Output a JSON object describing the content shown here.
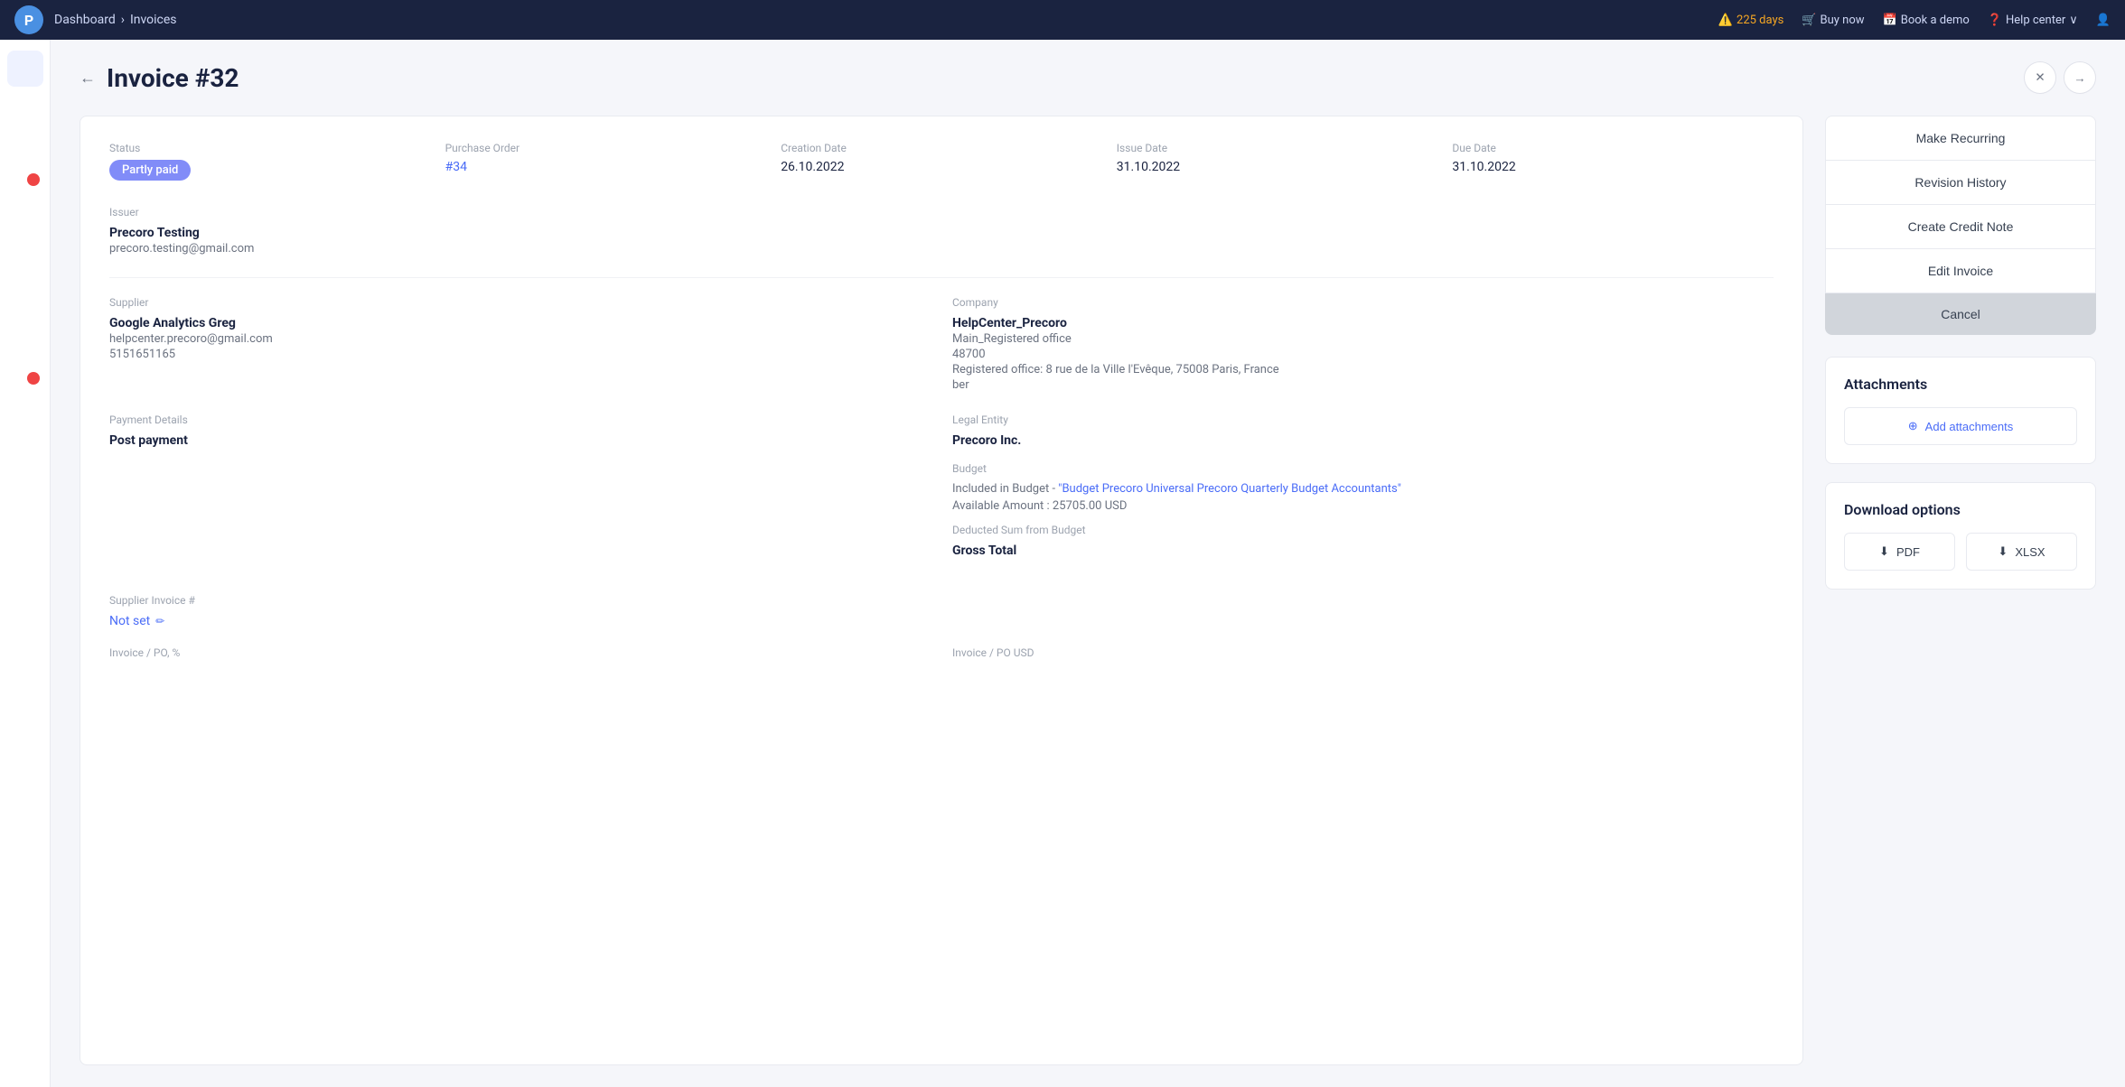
{
  "topnav": {
    "logo_text": "P",
    "breadcrumb": {
      "dashboard": "Dashboard",
      "invoices": "Invoices"
    },
    "warning_days": "225 days",
    "buy_now": "Buy now",
    "book_demo": "Book a demo",
    "help_center": "Help center"
  },
  "sidebar": {
    "items": [
      {
        "id": "home",
        "icon": "home"
      },
      {
        "id": "search",
        "icon": "search"
      },
      {
        "id": "people",
        "icon": "people"
      },
      {
        "id": "orders",
        "icon": "orders",
        "badge": ""
      },
      {
        "id": "documents",
        "icon": "documents"
      },
      {
        "id": "lock",
        "icon": "lock"
      },
      {
        "id": "list",
        "icon": "list"
      },
      {
        "id": "chart",
        "icon": "chart"
      },
      {
        "id": "calendar",
        "icon": "calendar",
        "badge": ""
      },
      {
        "id": "settings",
        "icon": "settings"
      }
    ]
  },
  "page": {
    "title": "Invoice #32",
    "back_label": "←",
    "close_icon": "✕",
    "next_icon": "→"
  },
  "invoice": {
    "status_label": "Status",
    "status_value": "Partly paid",
    "purchase_order_label": "Purchase Order",
    "purchase_order_value": "#34",
    "creation_date_label": "Creation Date",
    "creation_date_value": "26.10.2022",
    "issue_date_label": "Issue Date",
    "issue_date_value": "31.10.2022",
    "due_date_label": "Due Date",
    "due_date_value": "31.10.2022",
    "issuer_label": "Issuer",
    "issuer_name": "Precoro Testing",
    "issuer_email": "precoro.testing@gmail.com",
    "supplier_label": "Supplier",
    "supplier_name": "Google Analytics Greg",
    "supplier_email": "helpcenter.precoro@gmail.com",
    "supplier_phone": "5151651165",
    "company_label": "Company",
    "company_name": "HelpCenter_Precoro",
    "company_office1": "Main_Registered office",
    "company_code": "48700",
    "company_address": "Registered office: 8 rue de la Ville l'Evêque, 75008 Paris, France",
    "company_suffix": "ber",
    "payment_details_label": "Payment Details",
    "payment_details_value": "Post payment",
    "legal_entity_label": "Legal Entity",
    "legal_entity_value": "Precoro Inc.",
    "budget_label": "Budget",
    "budget_included_text": "Included in Budget - ",
    "budget_link_text": "\"Budget Precoro Universal Precoro Quarterly Budget Accountants\"",
    "available_amount_label": "Available Amount : 25705.00 USD",
    "deducted_sum_label": "Deducted Sum from Budget",
    "gross_total_label": "Gross Total",
    "supplier_invoice_label": "Supplier Invoice #",
    "not_set_text": "Not set",
    "invoice_po_label": "Invoice / PO, %",
    "invoice_po_usd_label": "Invoice / PO USD"
  },
  "actions": {
    "make_recurring": "Make Recurring",
    "revision_history": "Revision History",
    "create_credit_note": "Create Credit Note",
    "edit_invoice": "Edit Invoice",
    "cancel": "Cancel"
  },
  "attachments": {
    "title": "Attachments",
    "add_button": "Add attachments"
  },
  "download": {
    "title": "Download options",
    "pdf": "PDF",
    "xlsx": "XLSX"
  }
}
